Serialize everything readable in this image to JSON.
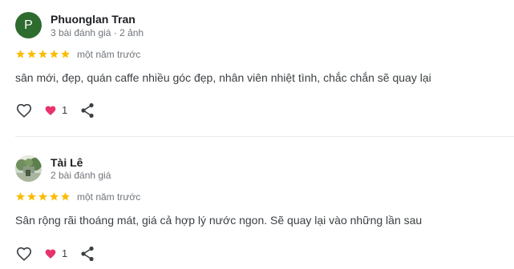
{
  "reviews": [
    {
      "avatar_letter": "P",
      "avatar_color": "#2e6b2e",
      "name": "Phuonglan Tran",
      "meta": "3 bài đánh giá · 2 ảnh",
      "rating": 5,
      "date": "một năm trước",
      "text": "sân mới, đẹp, quán caffe nhiều góc đẹp, nhân viên nhiệt tình, chắc chắn sẽ quay lại",
      "reaction_count": "1"
    },
    {
      "avatar_letter": "",
      "name": "Tài Lê",
      "meta": "2 bài đánh giá",
      "rating": 5,
      "date": "một năm trước",
      "text": "Sân rộng rãi thoáng mát, giá cả hợp lý nước ngon. Sẽ quay lại vào những lần sau",
      "reaction_count": "1"
    }
  ],
  "colors": {
    "star": "#fbbc04",
    "reaction_heart": "#e8336a",
    "icon": "#3c4043"
  }
}
